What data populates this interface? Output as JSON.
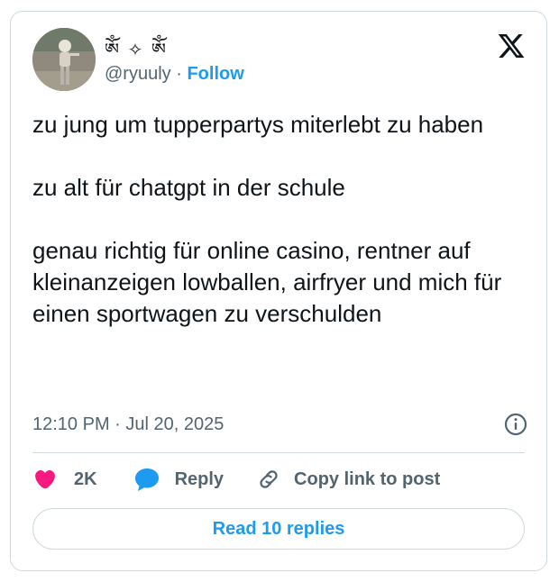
{
  "author": {
    "display_name": "ༀ ✧ ༀ",
    "handle": "@ryuuly",
    "separator": "·",
    "follow_label": "Follow"
  },
  "tweet": {
    "text": "zu jung um tupperpartys miterlebt zu haben\n\nzu alt für chatgpt in der schule\n\ngenau richtig für online casino, rentner auf kleinanzeigen lowballen, airfryer und mich für einen sportwagen zu verschulden",
    "timestamp": "12:10 PM · Jul 20, 2025"
  },
  "actions": {
    "like_count": "2K",
    "reply_label": "Reply",
    "copy_link_label": "Copy link to post"
  },
  "read_replies_label": "Read 10 replies",
  "icons": {
    "logo": "x-logo-icon",
    "info": "info-icon",
    "like": "heart-icon",
    "reply": "speech-bubble-icon",
    "copy": "link-icon"
  },
  "colors": {
    "accent": "#1d9bf0",
    "like": "#f91880",
    "muted_text": "#536471",
    "border": "#cfd9de"
  }
}
